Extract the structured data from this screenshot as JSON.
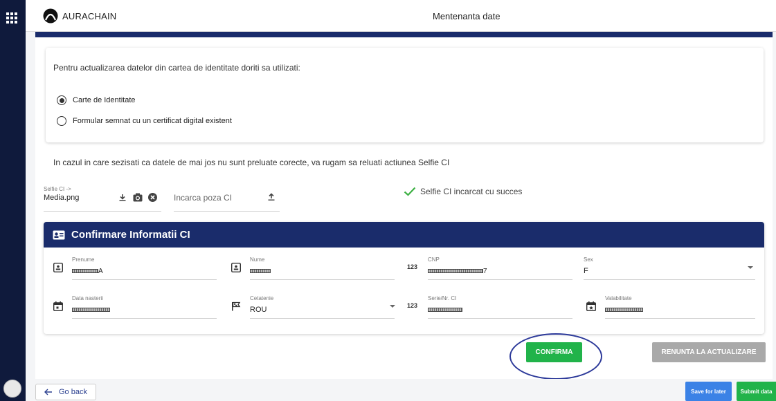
{
  "app": {
    "logo_text": "AURACHAIN",
    "title": "Mentenanta date"
  },
  "card": {
    "question": "Pentru actualizarea datelor din cartea de identitate doriti sa utilizati:",
    "options": [
      {
        "label": "Carte de Identitate",
        "selected": true
      },
      {
        "label": "Formular semnat cu un certificat digital existent",
        "selected": false
      }
    ]
  },
  "notice": "In cazul in care sezisati ca datele de mai jos nu sunt preluate corecte, va rugam sa reluati actiunea Selfie CI",
  "selfie": {
    "label": "Selfie CI ->",
    "value": "Media.png",
    "upload_placeholder": "Incarca poza CI",
    "success_text": "Selfie CI incarcat cu succes"
  },
  "ci_panel": {
    "title": "Confirmare Informatii CI",
    "fields": {
      "prenume": {
        "label": "Prenume",
        "value": ""
      },
      "nume": {
        "label": "Nume",
        "value": ""
      },
      "cnp": {
        "label": "CNP",
        "value": "7"
      },
      "sex": {
        "label": "Sex",
        "value": "F"
      },
      "data_nasterii": {
        "label": "Data nasterii",
        "value": ""
      },
      "cetatenie": {
        "label": "Cetatenie",
        "value": "ROU"
      },
      "serie": {
        "label": "Serie/Nr. CI",
        "value": ""
      },
      "valabilitate": {
        "label": "Valabilitate",
        "value": ""
      }
    },
    "numeric_icon_text": "123"
  },
  "actions": {
    "confirm": "CONFIRMA",
    "cancel": "RENUNTA LA ACTUALIZARE"
  },
  "footer": {
    "go_back": "Go back",
    "save_for_later": "Save for later",
    "submit": "Submit data"
  },
  "colors": {
    "navy": "#1a2c6b",
    "green": "#21b34a",
    "blue": "#3b82e6",
    "grey_button": "#a9a9a9"
  }
}
